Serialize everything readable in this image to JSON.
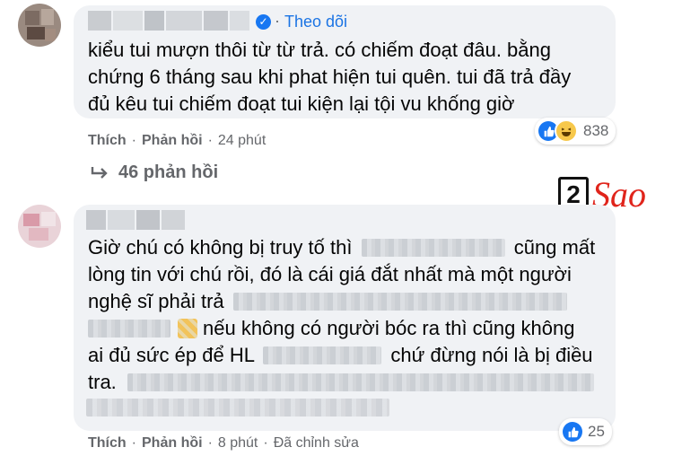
{
  "comment1": {
    "follow_label": "Theo dõi",
    "lines": [
      "kiểu tui mượn thôi từ từ trả. có chiếm đoạt đâu. bằng",
      "chứng 6 tháng sau khi phat hiện tui quên. tui đã trả đầy",
      "đủ kêu tui chiếm đoạt tui kiện lại tội vu khống giờ"
    ],
    "reaction_count": "838",
    "reactions": [
      "like-icon",
      "haha-icon"
    ],
    "actions": {
      "like": "Thích",
      "reply": "Phản hồi",
      "time": "24 phút"
    }
  },
  "replies_link": "46 phản hồi",
  "logo": {
    "number": "2",
    "text": "Sao"
  },
  "comment2": {
    "line1a": "Giờ chú có không bị truy tố thì",
    "line1b": "cũng mất",
    "line2": "lòng tin với chú rồi, đó là cái giá đắt nhất mà một người",
    "line3": "nghệ sĩ phải trả",
    "line4": "nếu không có người bóc ra thì cũng không",
    "line5a": "ai đủ sức ép để HL",
    "line5b": "chứ đừng nói là bị điều",
    "line6": "tra.",
    "reaction_count": "25",
    "reactions": [
      "like-icon"
    ],
    "actions": {
      "like": "Thích",
      "reply": "Phản hồi",
      "time": "8 phút",
      "edited": "Đã chỉnh sửa"
    }
  },
  "colors": {
    "accent": "#1877f2",
    "link": "#1b74e4",
    "bubble": "#f0f2f5",
    "meta": "#65676b",
    "logo_red": "#e0241b"
  }
}
